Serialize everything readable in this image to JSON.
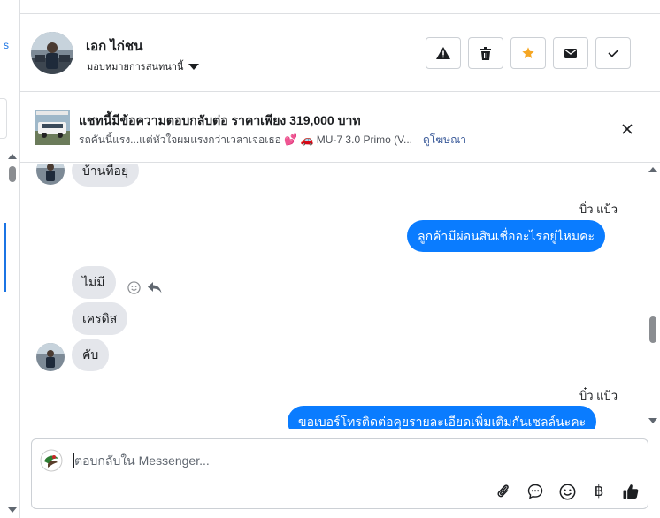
{
  "conversation": {
    "name": "เอก ไก่ชน",
    "assign_label": "มอบหมายการสนทนานี้"
  },
  "actions": [
    {
      "name": "alert-icon"
    },
    {
      "name": "trash-icon"
    },
    {
      "name": "star-icon",
      "color": "#f5a623"
    },
    {
      "name": "envelope-icon"
    },
    {
      "name": "check-icon"
    }
  ],
  "ad": {
    "title": "แชทนี้มีข้อความตอบกลับต่อ ราคาเพียง 319,000 บาท",
    "subtitle": "รถคันนี้แรง...แต่หัวใจผมแรงกว่าเวลาเจอเธอ 💕 🚗 MU-7 3.0 Primo (V...",
    "link": "ดูโฆษณา"
  },
  "messages": [
    {
      "direction": "in",
      "text": "บ้านที่อยุ่"
    },
    {
      "direction": "out",
      "sender": "บิ๋ว แป้ว",
      "text": "ลูกค้ามีผ่อนสินเชื่ออะไรอยู่ไหมคะ"
    },
    {
      "direction": "in",
      "text": "ไม่มี"
    },
    {
      "direction": "in",
      "text": "เครดิส"
    },
    {
      "direction": "in",
      "text": "คับ"
    },
    {
      "direction": "out",
      "sender": "บิ๋ว แป้ว",
      "text": "ขอเบอร์โทรติดต่อคุยรายละเอียดเพิ่มเติมกันเซลล์นะคะ"
    }
  ],
  "composer": {
    "placeholder": "ตอบกลับใน Messenger..."
  },
  "composer_tools": [
    "paperclip-icon",
    "speech-bubble-icon",
    "emoji-icon",
    "baht-icon",
    "thumbs-up-icon"
  ],
  "composer_tool_glyphs": {
    "baht": "฿"
  },
  "colors": {
    "outgoing_bubble": "#0a7cff",
    "incoming_bubble": "#e4e6eb",
    "link": "#385898",
    "accent": "#1b74e4"
  }
}
